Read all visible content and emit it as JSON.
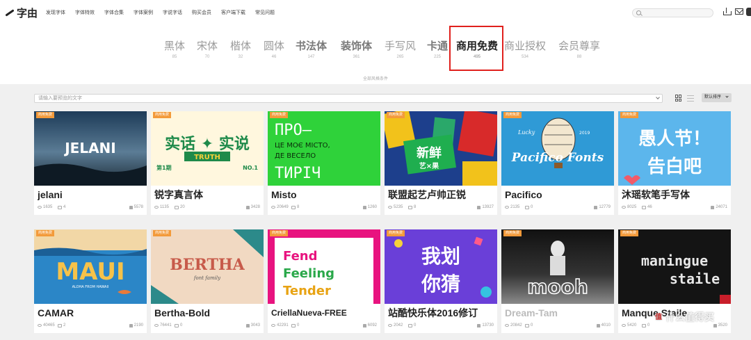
{
  "brand": {
    "name": "字由"
  },
  "nav": [
    {
      "label": "发现字体"
    },
    {
      "label": "字体特效"
    },
    {
      "label": "字体合集"
    },
    {
      "label": "字体案例"
    },
    {
      "label": "字说字话"
    },
    {
      "label": "购买会员"
    },
    {
      "label": "客户端下载"
    },
    {
      "label": "常见问题"
    }
  ],
  "categories": [
    {
      "name": "黑体",
      "count": "85"
    },
    {
      "name": "宋体",
      "count": "70"
    },
    {
      "name": "楷体",
      "count": "32"
    },
    {
      "name": "圆体",
      "count": "46"
    },
    {
      "name": "书法体",
      "count": "147"
    },
    {
      "name": "装饰体",
      "count": "361"
    },
    {
      "name": "手写风",
      "count": "265"
    },
    {
      "name": "卡通",
      "count": "225"
    },
    {
      "name": "商用免费",
      "count": "495"
    },
    {
      "name": "商业授权",
      "count": "534"
    },
    {
      "name": "会员尊享",
      "count": "88"
    }
  ],
  "all_link": "全部风格条件",
  "filter": {
    "placeholder": "请输入要预览的文字"
  },
  "sort": {
    "label": "默认排序"
  },
  "badge_label": "商用免费",
  "cards": [
    {
      "title": "jelani",
      "image_text": "JELANI",
      "views": "1635",
      "comments": "4",
      "likes": "5578"
    },
    {
      "title": "锐字真言体",
      "image_text": "实话 ✦ 实说",
      "image_sub": "TRUTH",
      "image_ep": "第1期",
      "image_no": "NO.1",
      "views": "1135",
      "comments": "20",
      "likes": "3428"
    },
    {
      "title": "Misto",
      "image_text": "ПРО—",
      "image_line2": "ЦЕ МОЄ МІСТО,",
      "image_line3": "ДЕ ВЕСЕЛО",
      "image_line4": "ТИРІЧ",
      "views": "20649",
      "comments": "8",
      "likes": "1260"
    },
    {
      "title": "联盟起艺卢帅正锐",
      "image_text": "新鲜",
      "image_sub": "艺×果",
      "views": "5235",
      "comments": "8",
      "likes": "13927"
    },
    {
      "title": "Pacifico",
      "image_text": "Pacifico Fonts",
      "image_sub": "Lucky",
      "image_year": "2019",
      "views": "2135",
      "comments": "0",
      "likes": "12779"
    },
    {
      "title": "沐瑶软笔手写体",
      "image_text": "愚人节！",
      "image_line2": "告白吧",
      "views": "8025",
      "comments": "46",
      "likes": "24071"
    },
    {
      "title": "CAMAR",
      "image_text": "MAUI",
      "image_sub": "ALOHA FROM HAWAII",
      "views": "40465",
      "comments": "2",
      "likes": "2190"
    },
    {
      "title": "Bertha-Bold",
      "image_text": "BERTHA",
      "image_sub": "font family",
      "views": "76441",
      "comments": "0",
      "likes": "3043"
    },
    {
      "title": "CriellaNueva-FREE",
      "image_text": "Fend",
      "image_line2": "Feeling",
      "image_line3": "Tender",
      "views": "42291",
      "comments": "0",
      "likes": "6092"
    },
    {
      "title": "站酷快乐体2016修订",
      "image_text": "我划",
      "image_line2": "你猜",
      "views": "2042",
      "comments": "0",
      "likes": "13730"
    },
    {
      "title": "Dream-Tam",
      "image_text": "mooh",
      "views": "20842",
      "comments": "0",
      "likes": "4010"
    },
    {
      "title": "Manque Staile",
      "image_text": "maningue",
      "image_line2": "staile",
      "views": "5420",
      "comments": "0",
      "likes": "3520"
    }
  ],
  "watermark": "什么值得买",
  "colors": {
    "highlight": "#e0201c",
    "badge": "#f39a3a"
  }
}
